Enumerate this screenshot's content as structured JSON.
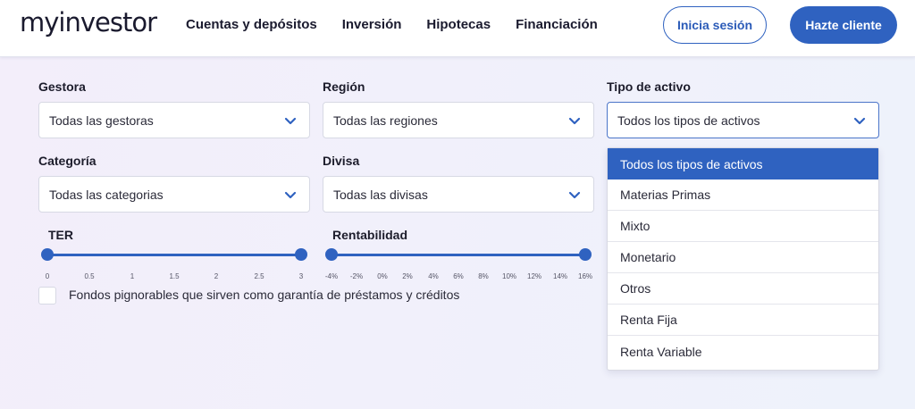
{
  "header": {
    "logo": "myinvestor",
    "nav": [
      "Cuentas y depósitos",
      "Inversión",
      "Hipotecas",
      "Financiación"
    ],
    "login_label": "Inicia sesión",
    "signup_label": "Hazte cliente"
  },
  "filters": {
    "gestora": {
      "label": "Gestora",
      "value": "Todas las gestoras"
    },
    "region": {
      "label": "Región",
      "value": "Todas las regiones"
    },
    "tipo": {
      "label": "Tipo de activo",
      "value": "Todos los tipos de activos"
    },
    "categoria": {
      "label": "Categoría",
      "value": "Todas las categorias"
    },
    "divisa": {
      "label": "Divisa",
      "value": "Todas las divisas"
    }
  },
  "sliders": {
    "ter": {
      "label": "TER",
      "ticks": [
        "0",
        "0.5",
        "1",
        "1.5",
        "2",
        "2.5",
        "3"
      ],
      "min_value": "0",
      "max_value": "3"
    },
    "rentabilidad": {
      "label": "Rentabilidad",
      "ticks": [
        "-4%",
        "-2%",
        "0%",
        "2%",
        "4%",
        "6%",
        "8%",
        "10%",
        "12%",
        "14%",
        "16%"
      ],
      "min_value": "-4%",
      "max_value": "16%"
    }
  },
  "checkbox": {
    "label": "Fondos pignorables que sirven como garantía de préstamos y créditos",
    "checked": false
  },
  "dropdown": {
    "options": [
      "Todos los tipos de activos",
      "Materias Primas",
      "Mixto",
      "Monetario",
      "Otros",
      "Renta Fija",
      "Renta Variable"
    ],
    "selected_index": 0
  },
  "colors": {
    "accent": "#2f62c0",
    "background": "#f2f0fa"
  },
  "icons": {
    "select_chevron": "chevron-down-icon"
  }
}
